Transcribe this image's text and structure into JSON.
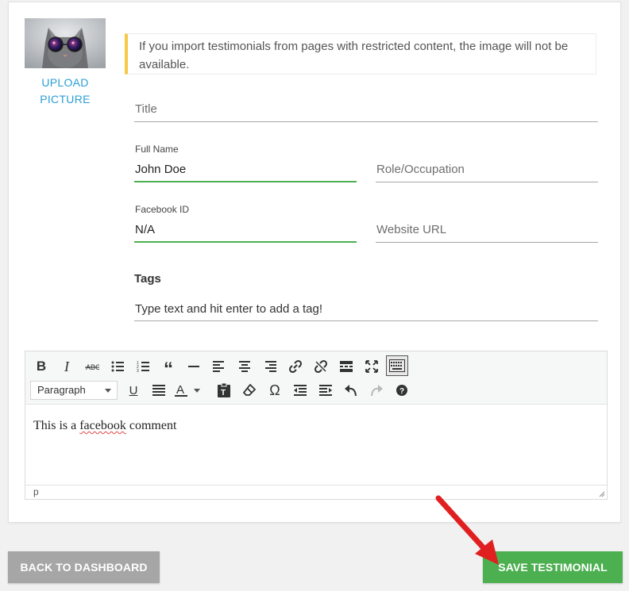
{
  "profile": {
    "upload_line1": "UPLOAD",
    "upload_line2": "PICTURE"
  },
  "notice": {
    "text": "If you import testimonials from pages with restricted content, the image will not be available.",
    "accent_color": "#f7c948"
  },
  "form": {
    "title": {
      "placeholder": "Title"
    },
    "full_name": {
      "label": "Full Name",
      "value": "John Doe"
    },
    "role": {
      "placeholder": "Role/Occupation"
    },
    "facebook_id": {
      "label": "Facebook ID",
      "value": "N/A"
    },
    "website": {
      "placeholder": "Website URL"
    },
    "tags": {
      "heading": "Tags",
      "placeholder": "Type text and hit enter to add a tag!"
    },
    "active_underline_color": "#4caf50"
  },
  "editor": {
    "toolbar_row1": [
      "bold-icon",
      "italic-icon",
      "strikethrough-icon",
      "bullet-list-icon",
      "numbered-list-icon",
      "blockquote-icon",
      "horizontal-line-icon",
      "align-left-icon",
      "align-center-icon",
      "align-right-icon",
      "link-icon",
      "unlink-icon",
      "read-more-icon",
      "fullscreen-icon",
      "toolbar-toggle-icon"
    ],
    "format_selected": "Paragraph",
    "toolbar_row2": [
      "underline-icon",
      "justify-icon",
      "text-color-icon",
      "paste-text-icon",
      "clear-formatting-icon",
      "special-character-icon",
      "outdent-icon",
      "indent-icon",
      "undo-icon",
      "redo-icon",
      "help-icon"
    ],
    "content_before": "This is a ",
    "content_misspelled": "facebook",
    "content_after": " comment",
    "status_path": "p"
  },
  "actions": {
    "back_label": "BACK TO DASHBOARD",
    "save_label": "SAVE TESTIMONIAL",
    "back_color": "#a6a6a6",
    "save_color": "#4caf50",
    "arrow_color": "#e02020"
  }
}
